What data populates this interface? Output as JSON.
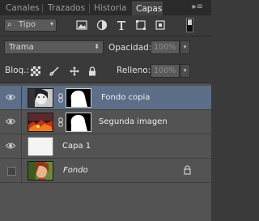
{
  "tabs": [
    {
      "label": "Canales",
      "active": false
    },
    {
      "label": "Trazados",
      "active": false
    },
    {
      "label": "Historia",
      "active": false
    },
    {
      "label": "Capas",
      "active": true
    }
  ],
  "panel_menu_icon": "panel-menu-icon",
  "filter": {
    "kind_label": "Tipo",
    "icons": [
      "pixel-layer-filter-icon",
      "adjustment-layer-filter-icon",
      "type-layer-filter-icon",
      "shape-layer-filter-icon",
      "smart-object-filter-icon"
    ]
  },
  "blend_mode": "Trama",
  "opacity": {
    "label": "Opacidad:",
    "value": "100%"
  },
  "lock": {
    "label": "Bloq.:",
    "icons": [
      "lock-transparent-pixels-icon",
      "lock-image-pixels-icon",
      "lock-position-icon",
      "lock-all-icon"
    ]
  },
  "fill": {
    "label": "Relleno:",
    "value": "100%"
  },
  "layers": [
    {
      "name": "Fondo copia",
      "visible": true,
      "selected": true,
      "has_mask": true,
      "linked": true,
      "thumb": "portrait-bw",
      "locked": false,
      "italic": false
    },
    {
      "name": "Segunda imagen",
      "visible": true,
      "selected": false,
      "has_mask": true,
      "linked": true,
      "thumb": "fire-scene",
      "locked": false,
      "italic": false
    },
    {
      "name": "Capa 1",
      "visible": true,
      "selected": false,
      "has_mask": false,
      "linked": false,
      "thumb": "white",
      "locked": false,
      "italic": false
    },
    {
      "name": "Fondo",
      "visible": false,
      "selected": false,
      "has_mask": false,
      "linked": false,
      "thumb": "portrait-color",
      "locked": true,
      "italic": true
    }
  ],
  "colors": {
    "panel": "#535353",
    "selected": "#5c6e88",
    "background": "#3a3a3a"
  }
}
